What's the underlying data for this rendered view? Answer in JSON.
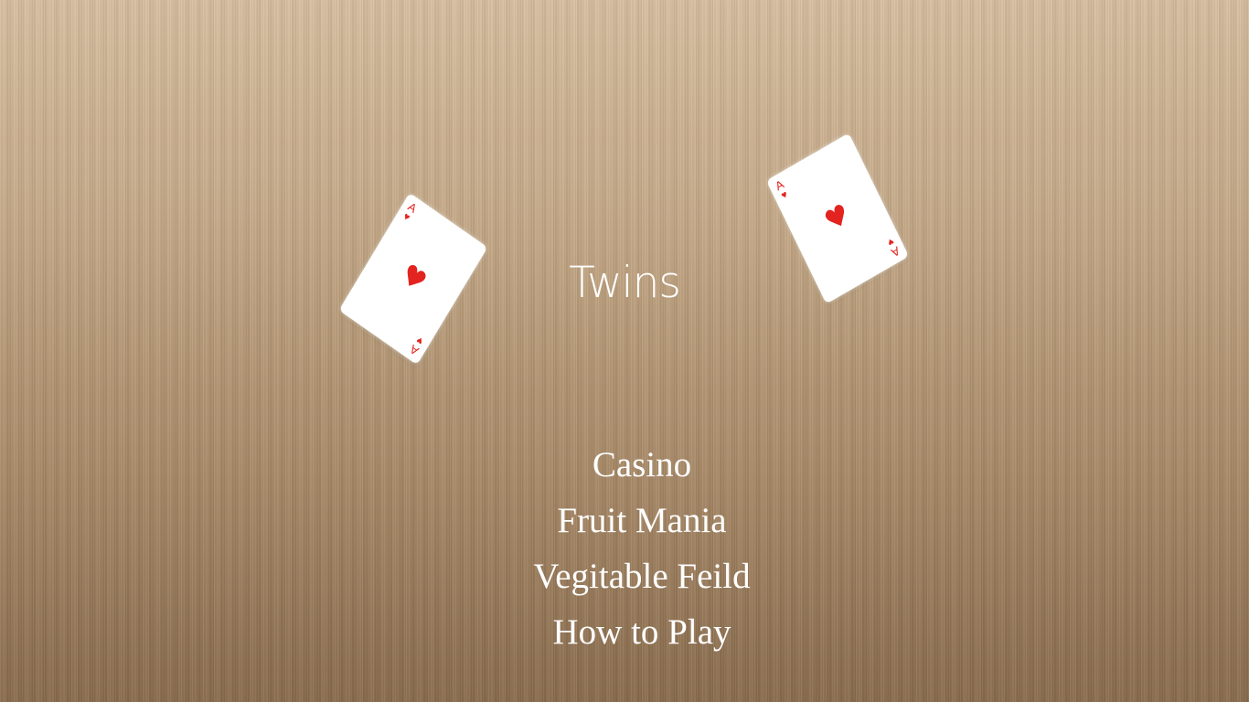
{
  "title": "Twins",
  "menu": {
    "items": [
      {
        "label": "Casino"
      },
      {
        "label": "Fruit Mania"
      },
      {
        "label": "Vegitable Feild"
      },
      {
        "label": "How to Play"
      }
    ]
  },
  "cards": {
    "left": {
      "rank": "A",
      "suit": "♥",
      "suit_name": "heart-icon"
    },
    "right": {
      "rank": "A",
      "suit": "♥",
      "suit_name": "heart-icon"
    }
  },
  "colors": {
    "text": "#ffffff",
    "suit_red": "#e3231f",
    "background_top": "#d7bea0",
    "background_bottom": "#8a6c4e"
  }
}
